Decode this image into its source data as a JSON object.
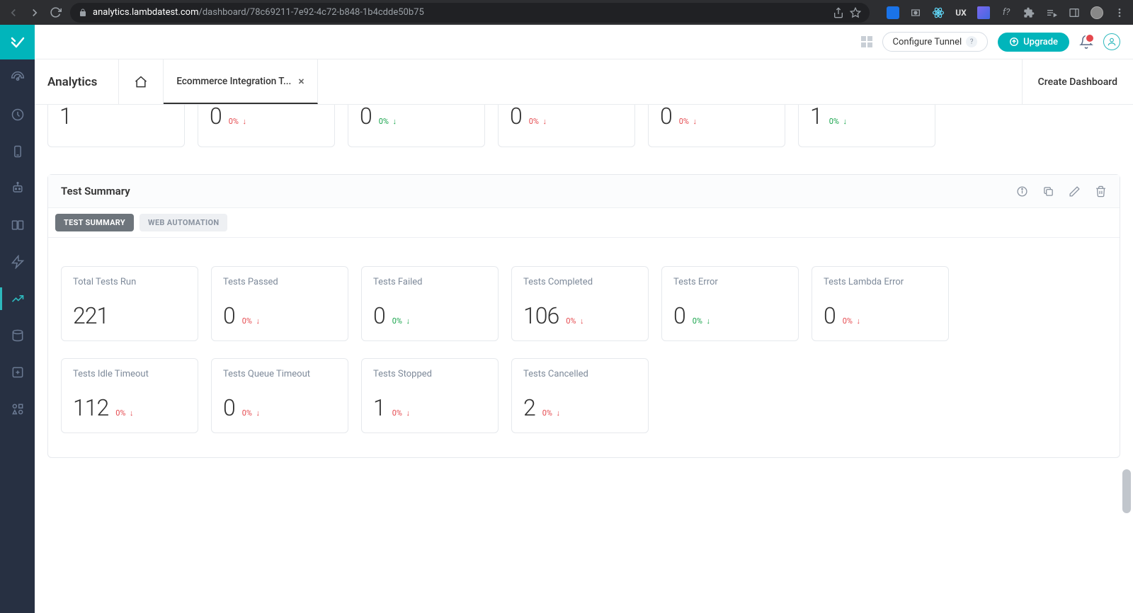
{
  "browser": {
    "url_domain": "analytics.lambdatest.com",
    "url_path": "/dashboard/78c69211-7e92-4c72-b848-1b4cdde50b75"
  },
  "topbar": {
    "configure_tunnel": "Configure Tunnel",
    "upgrade": "Upgrade"
  },
  "tabbar": {
    "title": "Analytics",
    "active_tab": "Ecommerce Integration T...",
    "create": "Create Dashboard"
  },
  "partial_row": [
    {
      "value": "1",
      "delta": "",
      "color": ""
    },
    {
      "value": "0",
      "delta": "0%",
      "color": "red"
    },
    {
      "value": "0",
      "delta": "0%",
      "color": "green"
    },
    {
      "value": "0",
      "delta": "0%",
      "color": "red"
    },
    {
      "value": "0",
      "delta": "0%",
      "color": "red"
    },
    {
      "value": "1",
      "delta": "0%",
      "color": "green"
    }
  ],
  "section": {
    "title": "Test Summary",
    "tab1": "TEST SUMMARY",
    "tab2": "WEB AUTOMATION"
  },
  "metrics_row1": [
    {
      "label": "Total Tests Run",
      "value": "221",
      "delta": "",
      "color": ""
    },
    {
      "label": "Tests Passed",
      "value": "0",
      "delta": "0%",
      "color": "red"
    },
    {
      "label": "Tests Failed",
      "value": "0",
      "delta": "0%",
      "color": "green"
    },
    {
      "label": "Tests Completed",
      "value": "106",
      "delta": "0%",
      "color": "red"
    },
    {
      "label": "Tests Error",
      "value": "0",
      "delta": "0%",
      "color": "green"
    },
    {
      "label": "Tests Lambda Error",
      "value": "0",
      "delta": "0%",
      "color": "red"
    }
  ],
  "metrics_row2": [
    {
      "label": "Tests Idle Timeout",
      "value": "112",
      "delta": "0%",
      "color": "red"
    },
    {
      "label": "Tests Queue Timeout",
      "value": "0",
      "delta": "0%",
      "color": "red"
    },
    {
      "label": "Tests Stopped",
      "value": "1",
      "delta": "0%",
      "color": "red"
    },
    {
      "label": "Tests Cancelled",
      "value": "2",
      "delta": "0%",
      "color": "red"
    }
  ]
}
